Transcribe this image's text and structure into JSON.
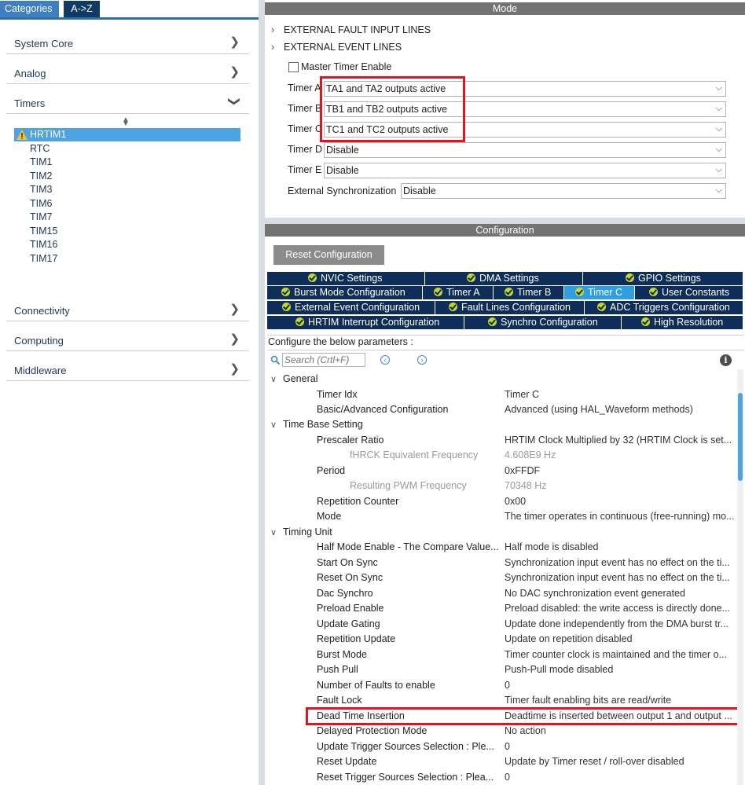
{
  "left_panel": {
    "tabs": {
      "categories": "Categories",
      "az": "A->Z"
    },
    "categories": [
      {
        "label": "System Core",
        "chevron": "chevron-right-icon"
      },
      {
        "label": "Analog",
        "chevron": "chevron-right-icon"
      },
      {
        "label": "Timers",
        "chevron": "chevron-down-icon"
      },
      {
        "label": "Connectivity",
        "chevron": "chevron-right-icon"
      },
      {
        "label": "Computing",
        "chevron": "chevron-right-icon"
      },
      {
        "label": "Middleware",
        "chevron": "chevron-right-icon"
      }
    ],
    "timers": {
      "selected": "HRTIM1",
      "items": [
        "RTC",
        "TIM1",
        "TIM2",
        "TIM3",
        "TIM6",
        "TIM7",
        "TIM15",
        "TIM16",
        "TIM17"
      ]
    }
  },
  "mode": {
    "header": "Mode",
    "expandables": [
      "EXTERNAL FAULT INPUT LINES",
      "EXTERNAL EVENT LINES"
    ],
    "master_timer_label": "Master Timer Enable",
    "selects": [
      {
        "label": "Timer A",
        "value": "TA1 and TA2 outputs active"
      },
      {
        "label": "Timer B",
        "value": "TB1 and TB2 outputs active"
      },
      {
        "label": "Timer C",
        "value": "TC1 and TC2 outputs active"
      },
      {
        "label": "Timer D",
        "value": "Disable"
      },
      {
        "label": "Timer E",
        "value": "Disable"
      },
      {
        "label": "External Synchronization",
        "value": "Disable"
      }
    ]
  },
  "configuration": {
    "header": "Configuration",
    "reset_label": "Reset Configuration",
    "tabs_row1": [
      "NVIC Settings",
      "DMA Settings",
      "GPIO Settings"
    ],
    "tabs_row2": [
      "Burst Mode Configuration",
      "Timer A",
      "Timer B",
      "Timer C",
      "User Constants"
    ],
    "tabs_row3": [
      "External Event Configuration",
      "Fault Lines Configuration",
      "ADC Triggers Configuration"
    ],
    "tabs_row4": [
      "HRTIM Interrupt Configuration",
      "Synchro Configuration",
      "High Resolution"
    ],
    "active_tab": "Timer C",
    "description": "Configure the below parameters :",
    "search_placeholder": "Search (Crtl+F)",
    "groups": [
      {
        "name": "General",
        "params": [
          {
            "name": "Timer Idx",
            "value": "Timer C"
          },
          {
            "name": "Basic/Advanced Configuration",
            "value": "Advanced (using HAL_Waveform methods)"
          }
        ]
      },
      {
        "name": "Time Base Setting",
        "params": [
          {
            "name": "Prescaler Ratio",
            "value": "HRTIM Clock Multiplied by 32 (HRTIM Clock is set..."
          },
          {
            "name": "fHRCK Equivalent Frequency",
            "value": "4.608E9 Hz",
            "sub": true
          },
          {
            "name": "Period",
            "value": "0xFFDF"
          },
          {
            "name": "Resulting PWM Frequency",
            "value": "70348 Hz",
            "sub": true
          },
          {
            "name": "Repetition Counter",
            "value": "0x00"
          },
          {
            "name": "Mode",
            "value": "The timer operates in continuous (free-running) mo..."
          }
        ]
      },
      {
        "name": "Timing Unit",
        "params": [
          {
            "name": "Half Mode Enable - The Compare Value...",
            "value": "Half mode is disabled"
          },
          {
            "name": "Start On Sync",
            "value": "Synchronization input event has no effect on the ti..."
          },
          {
            "name": "Reset On Sync",
            "value": "Synchronization input event has no effect on the ti..."
          },
          {
            "name": "Dac Synchro",
            "value": "No DAC synchronization event generated"
          },
          {
            "name": "Preload Enable",
            "value": "Preload disabled: the write access is directly done..."
          },
          {
            "name": "Update Gating",
            "value": "Update done independently from the DMA burst tr..."
          },
          {
            "name": "Repetition Update",
            "value": "Update on repetition disabled"
          },
          {
            "name": "Burst Mode",
            "value": "Timer counter clock is maintained and the timer o..."
          },
          {
            "name": "Push Pull",
            "value": "Push-Pull mode disabled"
          },
          {
            "name": "Number of Faults to enable",
            "value": "0"
          },
          {
            "name": "Fault Lock",
            "value": "Timer fault enabling bits are read/write"
          },
          {
            "name": "Dead Time Insertion",
            "value": "Deadtime is inserted between output 1 and output ..."
          },
          {
            "name": "Delayed Protection Mode",
            "value": "No action"
          },
          {
            "name": "Update Trigger Sources Selection : Ple...",
            "value": "0"
          },
          {
            "name": "Reset Update",
            "value": "Update by Timer reset / roll-over disabled"
          },
          {
            "name": "Reset Trigger Sources Selection : Plea...",
            "value": "0"
          }
        ]
      }
    ]
  },
  "colors": {
    "tab_dark": "#0e2d58",
    "tab_active": "#2f9ee0",
    "highlight_box": "#e0151f",
    "selected_item": "#4fa3e0",
    "section_header": "#737373"
  }
}
